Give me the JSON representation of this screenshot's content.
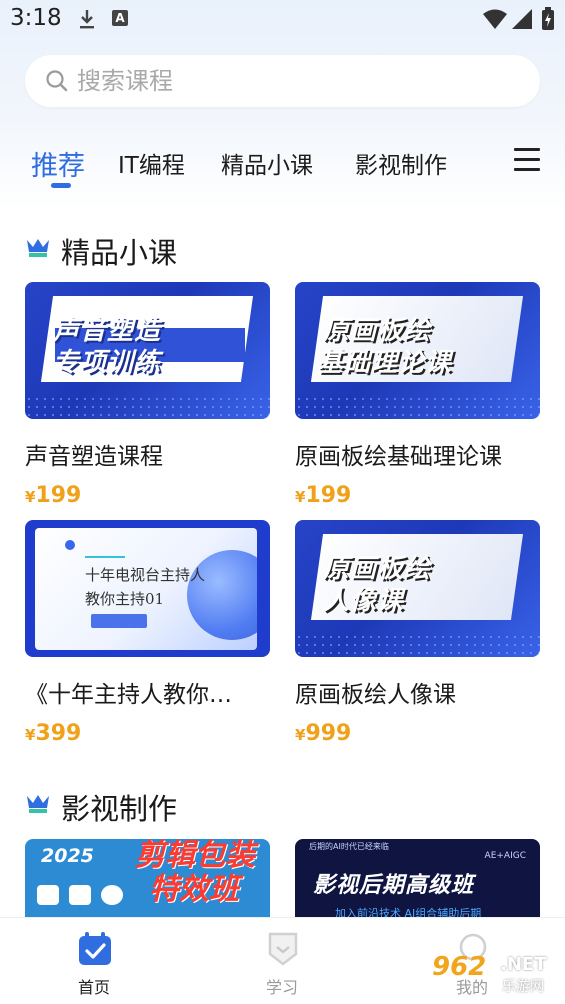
{
  "status": {
    "time": "3:18"
  },
  "search": {
    "placeholder": "搜索课程"
  },
  "tabs": [
    {
      "label": "推荐",
      "active": true
    },
    {
      "label": "IT编程"
    },
    {
      "label": "精品小课"
    },
    {
      "label": "影视制作"
    }
  ],
  "sections": [
    {
      "title": "精品小课",
      "courses": [
        {
          "title": "声音塑造课程",
          "price_symbol": "¥",
          "price": "199",
          "thumb_text_1": "声音塑造",
          "thumb_text_2": "专项训练"
        },
        {
          "title": "原画板绘基础理论课",
          "price_symbol": "¥",
          "price": "199",
          "thumb_text_1": "原画板绘",
          "thumb_text_2": "基础理论课"
        },
        {
          "title": "《十年主持人教你…",
          "price_symbol": "¥",
          "price": "399",
          "thumb_text_1": "十年电视台主持人",
          "thumb_text_2": "教你主持01"
        },
        {
          "title": "原画板绘人像课",
          "price_symbol": "¥",
          "price": "999",
          "thumb_text_1": "原画板绘",
          "thumb_text_2": "人像课"
        }
      ]
    },
    {
      "title": "影视制作",
      "courses": [
        {
          "thumb_year": "2025",
          "thumb_text_1": "剪辑包装",
          "thumb_text_2": "特效班"
        },
        {
          "thumb_top": "后期的AI时代已经来临",
          "thumb_tag": "AE+AIGC",
          "thumb_text_1": "影视后期高级班",
          "thumb_sub": "加入前沿技术 AI组合辅助后期"
        }
      ]
    }
  ],
  "bottom_nav": [
    {
      "label": "首页",
      "icon": "calendar-check-icon",
      "active": true
    },
    {
      "label": "学习",
      "icon": "shield-icon",
      "active": false
    },
    {
      "label": "我的",
      "icon": "user-icon",
      "active": false
    }
  ],
  "watermark": {
    "num": "962",
    "net": ".NET",
    "cn": "乐游网"
  },
  "colors": {
    "accent": "#2f6de0",
    "price": "#f0a11a",
    "thumb_blue": "#2744c8"
  }
}
